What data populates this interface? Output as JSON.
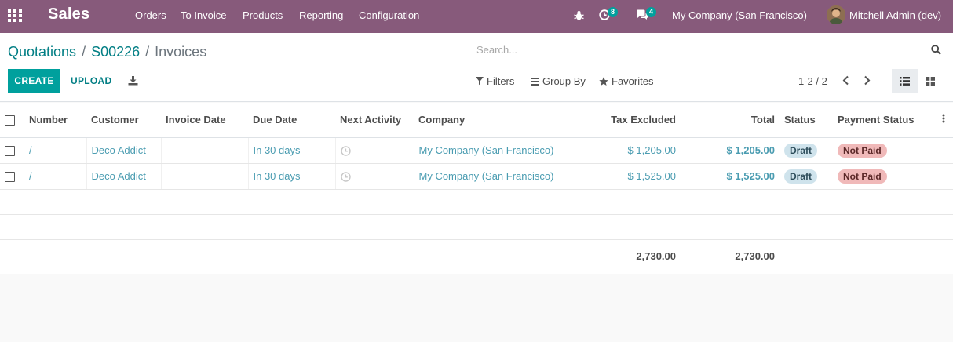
{
  "navbar": {
    "brand": "Sales",
    "menu": [
      "Orders",
      "To Invoice",
      "Products",
      "Reporting",
      "Configuration"
    ],
    "activities_count": "8",
    "messages_count": "4",
    "company": "My Company (San Francisco)",
    "user": "Mitchell Admin (dev)",
    "bg_color": "#875a7b"
  },
  "breadcrumb": {
    "level1": "Quotations",
    "level2": "S00226",
    "current": "Invoices"
  },
  "search": {
    "placeholder": "Search..."
  },
  "toolbar": {
    "create_label": "CREATE",
    "upload_label": "UPLOAD",
    "filters_label": "Filters",
    "groupby_label": "Group By",
    "favorites_label": "Favorites",
    "pager": "1-2 / 2",
    "accent": "#00a09d"
  },
  "table": {
    "headers": {
      "number": "Number",
      "customer": "Customer",
      "invoice_date": "Invoice Date",
      "due_date": "Due Date",
      "next_activity": "Next Activity",
      "company": "Company",
      "tax_excluded": "Tax Excluded",
      "total": "Total",
      "status": "Status",
      "payment_status": "Payment Status"
    },
    "rows": [
      {
        "number": "/",
        "customer": "Deco Addict",
        "invoice_date": "",
        "due_date": "In 30 days",
        "company": "My Company (San Francisco)",
        "tax_excluded": "$ 1,205.00",
        "total": "$ 1,205.00",
        "status": "Draft",
        "payment_status": "Not Paid"
      },
      {
        "number": "/",
        "customer": "Deco Addict",
        "invoice_date": "",
        "due_date": "In 30 days",
        "company": "My Company (San Francisco)",
        "tax_excluded": "$ 1,525.00",
        "total": "$ 1,525.00",
        "status": "Draft",
        "payment_status": "Not Paid"
      }
    ],
    "footer": {
      "tax_excluded_sum": "2,730.00",
      "total_sum": "2,730.00"
    }
  }
}
